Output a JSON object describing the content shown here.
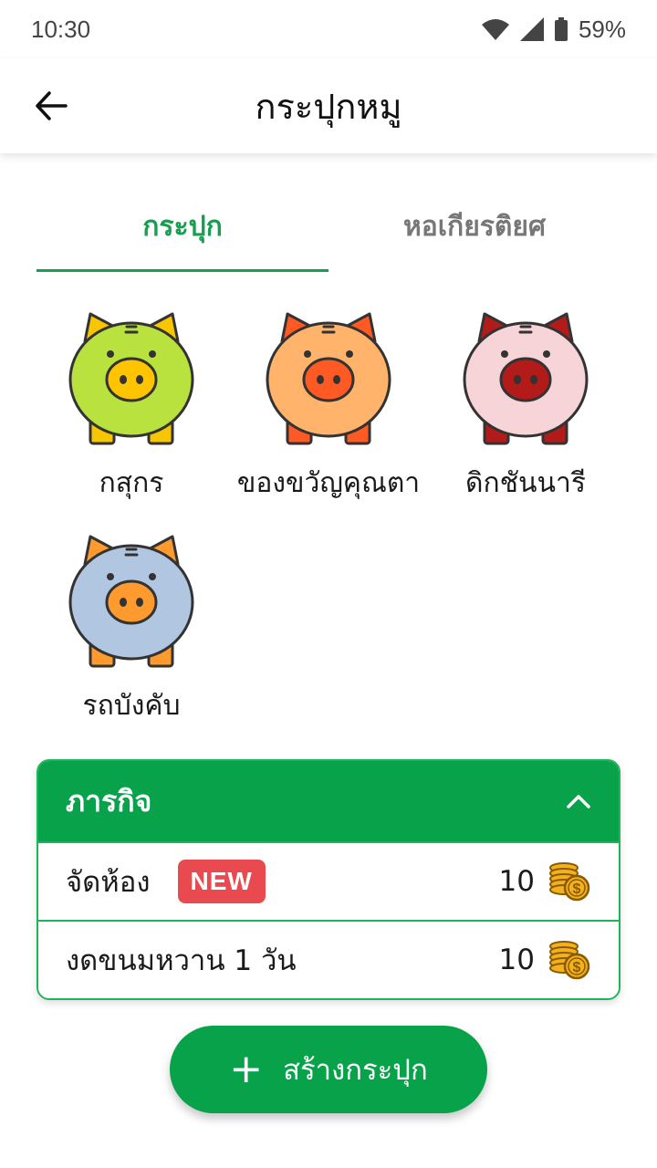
{
  "status_bar": {
    "time": "10:30",
    "battery": "59%"
  },
  "header": {
    "title": "กระปุกหมู"
  },
  "tabs": [
    {
      "label": "กระปุก",
      "active": true
    },
    {
      "label": "หอเกียรติยศ",
      "active": false
    }
  ],
  "piggy_banks": [
    {
      "name": "กสุกร",
      "body_color": "#b9e23f",
      "ear_color": "#f7c600",
      "snout_color": "#ffc400",
      "nostril_color": "#333333"
    },
    {
      "name": "ของขวัญคุณตา",
      "body_color": "#ffb36b",
      "ear_color": "#ff5a24",
      "snout_color": "#ff5a24",
      "nostril_color": "#333333"
    },
    {
      "name": "ดิกชันนารี",
      "body_color": "#f6d4d8",
      "ear_color": "#b31b1b",
      "snout_color": "#b31b1b",
      "nostril_color": "#333333"
    },
    {
      "name": "รถบังคับ",
      "body_color": "#b1c6e0",
      "ear_color": "#ff9a2e",
      "snout_color": "#ff9a2e",
      "nostril_color": "#333333"
    }
  ],
  "missions": {
    "title": "ภารกิจ",
    "items": [
      {
        "name": "จัดห้อง",
        "badge": "NEW",
        "reward": "10"
      },
      {
        "name": "งดขนมหวาน 1 วัน",
        "badge": "",
        "reward": "10"
      }
    ]
  },
  "create_button": {
    "label": "สร้างกระปุก"
  },
  "colors": {
    "primary": "#07a24a",
    "badge": "#e84a4f",
    "tab_active": "#14a04f"
  }
}
